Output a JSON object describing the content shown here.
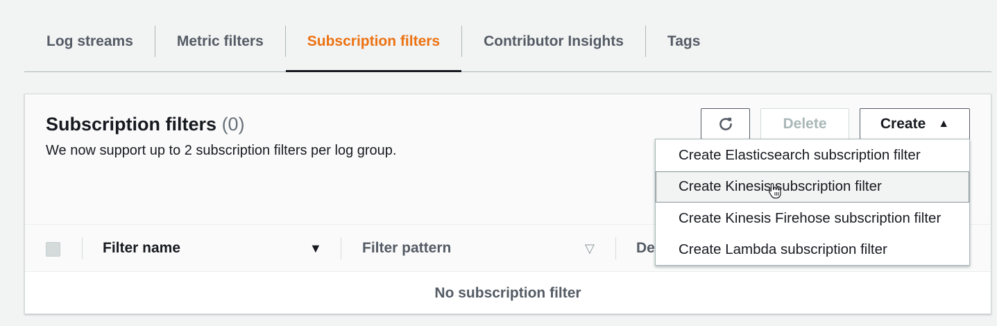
{
  "tabs": [
    {
      "label": "Log streams",
      "active": false
    },
    {
      "label": "Metric filters",
      "active": false
    },
    {
      "label": "Subscription filters",
      "active": true
    },
    {
      "label": "Contributor Insights",
      "active": false
    },
    {
      "label": "Tags",
      "active": false
    }
  ],
  "panel": {
    "title": "Subscription filters",
    "count": "(0)",
    "description": "We now support up to 2 subscription filters per log group.",
    "buttons": {
      "refresh_icon": "refresh-icon",
      "delete_label": "Delete",
      "create_label": "Create"
    }
  },
  "table": {
    "columns": [
      {
        "label": "Filter name",
        "sort_icon": "sort-descending-icon"
      },
      {
        "label": "Filter pattern",
        "sort_icon": "sort-none-icon"
      },
      {
        "label": "Des"
      }
    ],
    "empty_text": "No subscription filter"
  },
  "create_menu": {
    "items": [
      "Create Elasticsearch subscription filter",
      "Create Kinesis subscription filter",
      "Create Kinesis Firehose subscription filter",
      "Create Lambda subscription filter"
    ],
    "hovered_index": 1
  },
  "colors": {
    "active_tab": "#ec7211",
    "tab_text": "#545b64",
    "background": "#f2f3f3"
  }
}
